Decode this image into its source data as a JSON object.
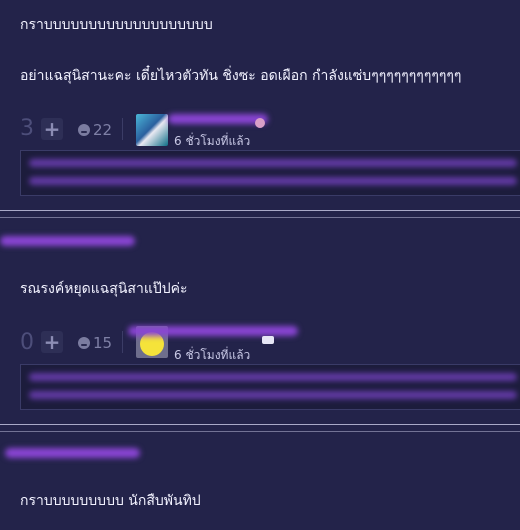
{
  "comments": [
    {
      "title": "กราบบบบบบบบบบบบบบบบบบบ",
      "body": "อย่าแฉสุนิสานะคะ เดี๋ยไหวตัวทัน ชิ่งซะ อดเผือก กำลังแซ่บๆๆๆๆๆๆๆๆๆๆๆๆ",
      "votes": "3",
      "emotion_count": "22",
      "time": "6 ชั่วโมงที่แล้ว"
    },
    {
      "body": "รณรงค์หยุดแฉสุนิสาแป๊ปค่ะ",
      "votes": "0",
      "emotion_count": "15",
      "time": "6 ชั่วโมงที่แล้ว"
    },
    {
      "body": "กราบบบบบบบบบ นักสืบพันทิป"
    }
  ],
  "colors": {
    "background": "#23234a",
    "redacted": "#8a45d4"
  },
  "icons": [
    "plus-icon",
    "emotion-icon",
    "avatar-icon",
    "smiley-avatar-icon"
  ]
}
